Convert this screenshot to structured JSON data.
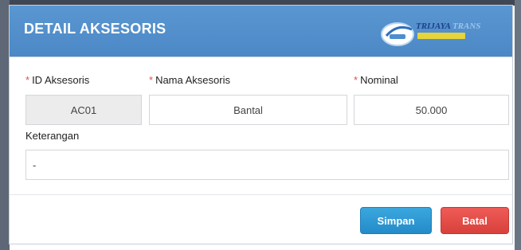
{
  "modal": {
    "title": "DETAIL AKSESORIS",
    "logo": {
      "name_main": "TRIJAYA",
      "name_alt": "TRANS"
    }
  },
  "form": {
    "required_mark": "*",
    "id_aksesoris": {
      "label": "ID Aksesoris",
      "value": "AC01"
    },
    "nama_aksesoris": {
      "label": "Nama Aksesoris",
      "value": "Bantal"
    },
    "nominal": {
      "label": "Nominal",
      "value": "50.000"
    },
    "keterangan": {
      "label": "Keterangan",
      "value": "-"
    }
  },
  "actions": {
    "save_label": "Simpan",
    "cancel_label": "Batal"
  },
  "colors": {
    "header": "#4b88c6",
    "save": "#248bc9",
    "cancel": "#d9413b",
    "required": "#d9534f"
  }
}
